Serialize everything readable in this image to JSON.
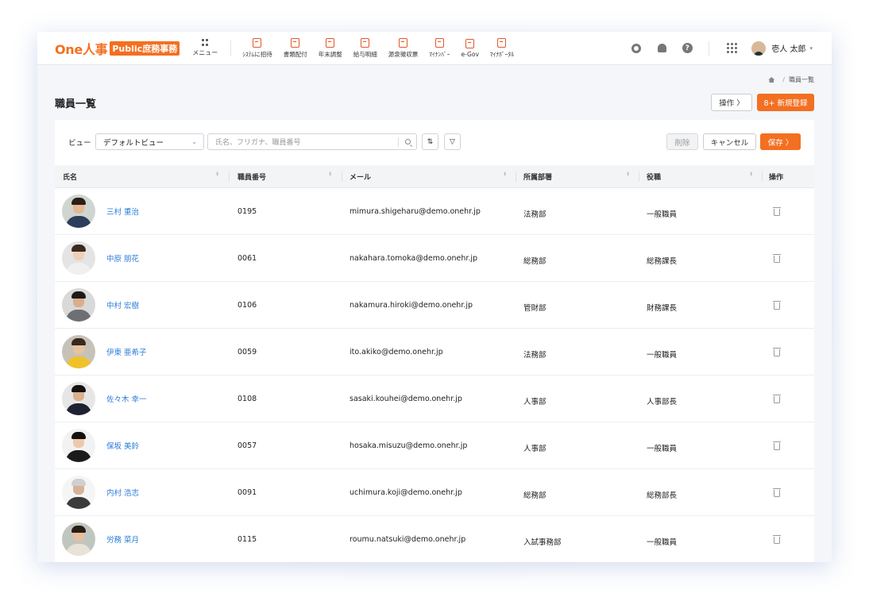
{
  "brand": {
    "logo_text": "One人事",
    "badge": "Public庶務事務"
  },
  "header": {
    "menu_label": "メニュー",
    "nav": [
      {
        "label": "ｼｽﾃﾑに招待",
        "icon": "invite-icon"
      },
      {
        "label": "書類配付",
        "icon": "document-distribute-icon"
      },
      {
        "label": "年末調整",
        "icon": "year-end-adjust-icon"
      },
      {
        "label": "給与明細",
        "icon": "payslip-icon"
      },
      {
        "label": "源泉徴収票",
        "icon": "withholding-slip-icon"
      },
      {
        "label": "ﾏｲﾅﾝﾊﾞｰ",
        "icon": "my-number-icon"
      },
      {
        "label": "e-Gov",
        "icon": "egov-icon"
      },
      {
        "label": "ﾏｲﾅﾎﾟｰﾀﾙ",
        "icon": "myna-portal-icon"
      }
    ],
    "help_glyph": "?",
    "user_name": "壱人 太郎",
    "user_caret": "▾"
  },
  "breadcrumb": {
    "sep": "/",
    "current": "職員一覧"
  },
  "page": {
    "title": "職員一覧",
    "ops_button": "操作 〉",
    "new_button": "8+ 新規登録"
  },
  "toolbar": {
    "view_label": "ビュー",
    "view_value": "デフォルトビュー",
    "view_chevron": "⌄",
    "search_placeholder": "氏名、フリガナ、職員番号",
    "sort_glyph": "⇅",
    "filter_glyph": "▽",
    "delete_label": "削除",
    "cancel_label": "キャンセル",
    "save_label": "保存 〉"
  },
  "table": {
    "headers": [
      "氏名",
      "職員番号",
      "メール",
      "所属部署",
      "役職",
      "操作"
    ],
    "sort_glyph": "⇕",
    "rows": [
      {
        "name": "三村 重治",
        "id": "0195",
        "email": "mimura.shigeharu@demo.onehr.jp",
        "dept": "法務部",
        "role": "一般職員",
        "skin": "#e3b893",
        "hair": "#2a1e16",
        "body": "#2c3e5c",
        "bg": "#cfd6cf"
      },
      {
        "name": "中原 朋花",
        "id": "0061",
        "email": "nakahara.tomoka@demo.onehr.jp",
        "dept": "総務部",
        "role": "総務課長",
        "skin": "#efcfb5",
        "hair": "#3a2a20",
        "body": "#f0f0f0",
        "bg": "#e4e4e4"
      },
      {
        "name": "中村 宏樹",
        "id": "0106",
        "email": "nakamura.hiroki@demo.onehr.jp",
        "dept": "管財部",
        "role": "財務課長",
        "skin": "#d9ae8c",
        "hair": "#1e1a17",
        "body": "#6d6f72",
        "bg": "#d9d9d9"
      },
      {
        "name": "伊東 亜希子",
        "id": "0059",
        "email": "ito.akiko@demo.onehr.jp",
        "dept": "法務部",
        "role": "一般職員",
        "skin": "#e8c3a0",
        "hair": "#3a281c",
        "body": "#f0c22a",
        "bg": "#c7c2b8"
      },
      {
        "name": "佐々木 幸一",
        "id": "0108",
        "email": "sasaki.kouhei@demo.onehr.jp",
        "dept": "人事部",
        "role": "人事部長",
        "skin": "#dbb08c",
        "hair": "#15120f",
        "body": "#1e2230",
        "bg": "#e6e6e6"
      },
      {
        "name": "保坂 美鈴",
        "id": "0057",
        "email": "hosaka.misuzu@demo.onehr.jp",
        "dept": "人事部",
        "role": "一般職員",
        "skin": "#ecc9ad",
        "hair": "#17110d",
        "body": "#1b1b1b",
        "bg": "#f2f2f2"
      },
      {
        "name": "内村 浩志",
        "id": "0091",
        "email": "uchimura.koji@demo.onehr.jp",
        "dept": "総務部",
        "role": "総務部長",
        "skin": "#d8b297",
        "hair": "#cfcfcf",
        "body": "#3b3b3b",
        "bg": "#f5f5f5"
      },
      {
        "name": "労務 菜月",
        "id": "0115",
        "email": "roumu.natsuki@demo.onehr.jp",
        "dept": "入試事務部",
        "role": "一般職員",
        "skin": "#e6bf9e",
        "hair": "#2a1d14",
        "body": "#e8e2d8",
        "bg": "#bfc6c0"
      }
    ]
  },
  "colors": {
    "accent": "#f36f21",
    "link": "#2b7bd8"
  }
}
